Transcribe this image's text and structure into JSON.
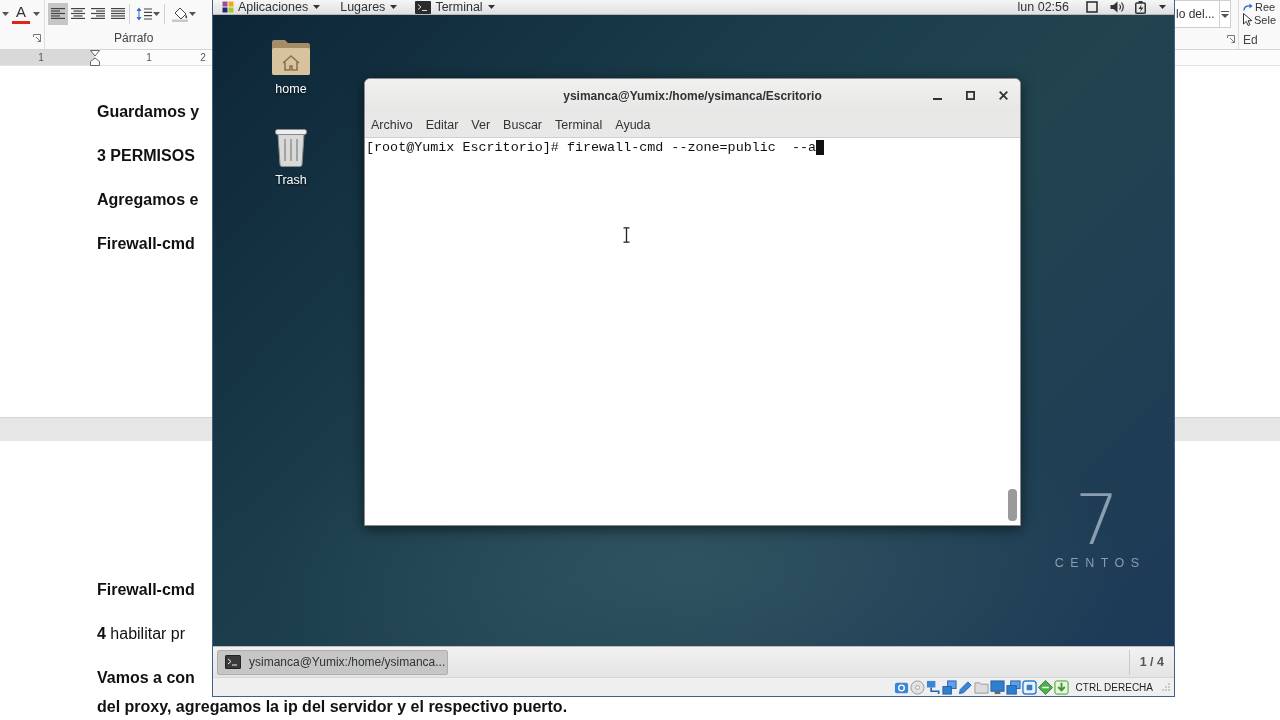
{
  "word": {
    "ribbon": {
      "font_color_button": {
        "label": "A"
      },
      "alignment_buttons": [
        {
          "kind": "left",
          "selected": true
        },
        {
          "kind": "center",
          "selected": false
        },
        {
          "kind": "right",
          "selected": false
        },
        {
          "kind": "justify",
          "selected": false
        }
      ],
      "paragraph_group_label": "Párrafo",
      "style_gallery_item": "lo del...",
      "editing_buttons": [
        {
          "kind": "replace",
          "label": "Ree"
        },
        {
          "kind": "select",
          "label": "Sele"
        }
      ],
      "editing_group_label": "Ed"
    },
    "ruler_numbers": [
      "1",
      "1",
      "2"
    ],
    "pages": [
      {
        "paragraphs": [
          {
            "lines": [
              "Guardamos y"
            ],
            "bold": true
          },
          {
            "lines": [
              "3 PERMISOS"
            ],
            "bold": true
          },
          {
            "lines": [
              "Agregamos e"
            ],
            "bold": true
          },
          {
            "lines": [
              "Firewall-cmd"
            ],
            "bold": true
          }
        ]
      },
      {
        "paragraphs": [
          {
            "lines": [
              "Firewall-cmd"
            ],
            "bold": true
          },
          {
            "lines": [
              "**4** habilitar pr"
            ],
            "bold": false
          },
          {
            "lines": [
              "Vamos a con",
              "del proxy, agregamos la ip del servidor y el respectivo puerto."
            ],
            "bold": true
          }
        ]
      }
    ]
  },
  "vm": {
    "top_bar": {
      "menus": [
        {
          "kind": "applications",
          "label": "Aplicaciones"
        },
        {
          "kind": "places",
          "label": "Lugares"
        },
        {
          "kind": "window",
          "label": "Terminal"
        }
      ],
      "clock": "lun 02:56"
    },
    "desktop_icons": [
      {
        "kind": "folder",
        "label": "home"
      },
      {
        "kind": "trash",
        "label": "Trash"
      }
    ],
    "terminal": {
      "title": "ysimanca@Yumix:/home/ysimanca/Escritorio",
      "menu": [
        "Archivo",
        "Editar",
        "Ver",
        "Buscar",
        "Terminal",
        "Ayuda"
      ],
      "lines": [
        "[root@Yumix Escritorio]# firewall-cmd --zone=public  --a"
      ]
    },
    "logo": {
      "number": "7",
      "name": "CENTOS"
    },
    "window_list": {
      "items": [
        {
          "label": "ysimanca@Yumix:/home/ysimanca...",
          "selected": true
        }
      ],
      "workspace": "1 / 4"
    },
    "status_bar": {
      "host_key": "CTRL DERECHA"
    }
  }
}
